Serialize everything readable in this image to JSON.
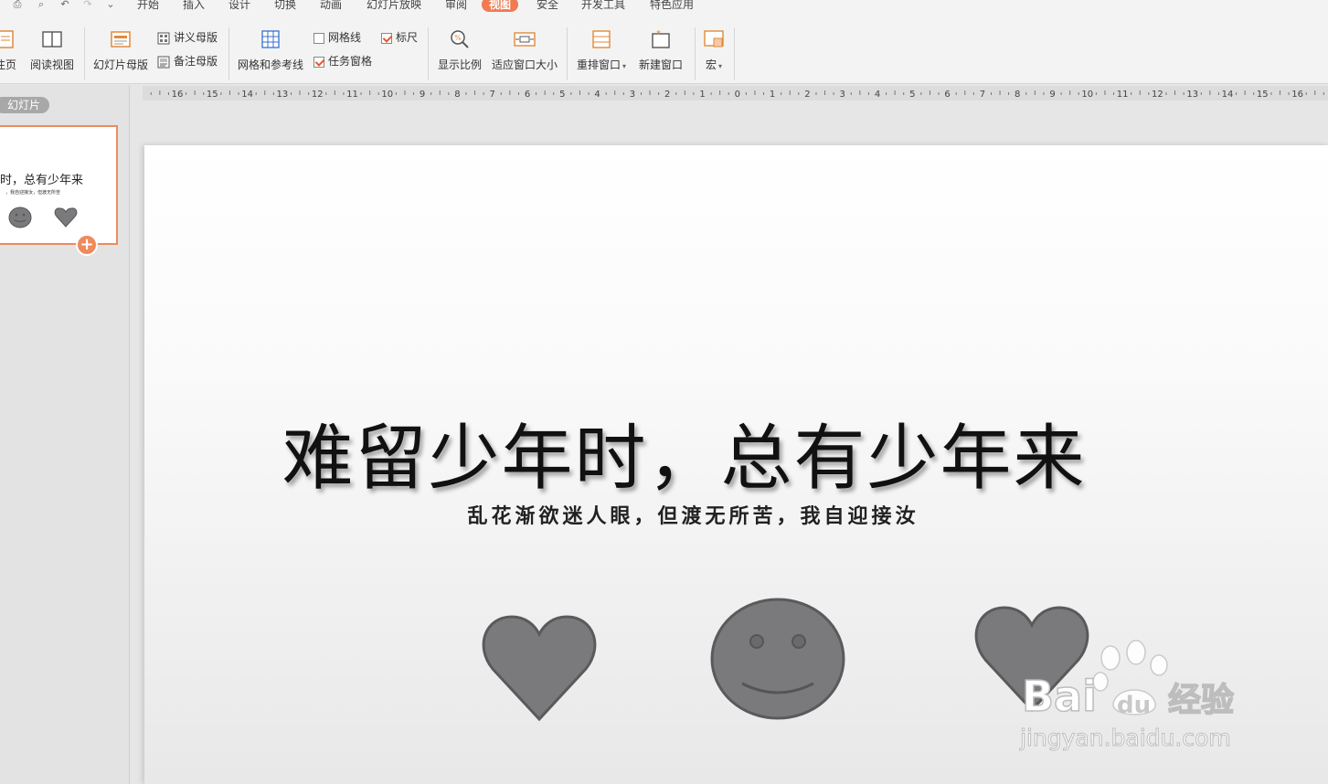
{
  "menu": {
    "tabs": [
      "开始",
      "插入",
      "设计",
      "切换",
      "动画",
      "幻灯片放映",
      "审阅",
      "视图",
      "安全",
      "开发工具",
      "特色应用"
    ],
    "active_tab": "视图"
  },
  "ribbon": {
    "notes_page": "注页",
    "reading_view": "阅读视图",
    "slide_master": "幻灯片母版",
    "handout_master": "讲义母版",
    "notes_master": "备注母版",
    "grid_guides": "网格和参考线",
    "gridlines": "网格线",
    "gridlines_checked": false,
    "task_pane": "任务窗格",
    "task_pane_checked": true,
    "ruler": "标尺",
    "ruler_checked": true,
    "zoom": "显示比例",
    "fit_window": "适应窗口大小",
    "arrange_windows": "重排窗口",
    "new_window": "新建窗口",
    "macro": "宏"
  },
  "panel": {
    "label": "幻灯片",
    "thumbnail_title": "时，总有少年来",
    "thumbnail_subtitle": "，我自迎接汝，但渡无所苦"
  },
  "ruler_numbers": [
    "16",
    "15",
    "14",
    "13",
    "12",
    "11",
    "10",
    "9",
    "8",
    "7",
    "6",
    "5",
    "4",
    "3",
    "2",
    "1",
    "0",
    "1",
    "2",
    "3",
    "4",
    "5",
    "6",
    "7",
    "8",
    "9",
    "10",
    "11",
    "12",
    "13",
    "14",
    "15",
    "16"
  ],
  "slide": {
    "title": "难留少年时，总有少年来",
    "subtitle": "乱花渐欲迷人眼，但渡无所苦，我自迎接汝"
  },
  "watermark": {
    "brand_latin": "Bai",
    "brand_tail": "du",
    "brand_cn": "经验",
    "url": "jingyan.baidu.com"
  },
  "colors": {
    "accent": "#f07a52",
    "shape_fill": "#7a7a7c",
    "shape_stroke": "#555555"
  }
}
